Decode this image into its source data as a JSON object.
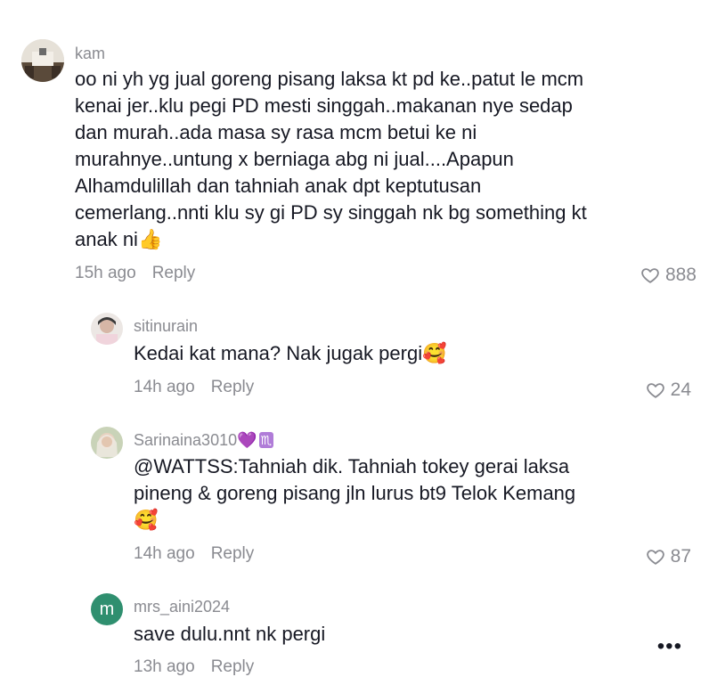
{
  "comments": [
    {
      "username": "kam",
      "text": "oo ni yh yg jual goreng pisang laksa kt pd ke..patut le mcm\nkenai jer..klu pegi PD mesti singgah..makanan nye sedap\ndan murah..ada masa sy rasa mcm betui ke ni\nmurahnye..untung x berniaga abg ni jual....Apapun\nAlhamdulillah dan tahniah anak dpt keptutusan\ncemerlang..nnti klu sy gi PD sy singgah nk bg something kt\nanak ni👍",
      "time": "15h ago",
      "reply_label": "Reply",
      "likes": "888"
    },
    {
      "username": "sitinurain",
      "text": "Kedai kat mana? Nak jugak pergi🥰",
      "time": "14h ago",
      "reply_label": "Reply",
      "likes": "24"
    },
    {
      "username": "Sarinaina3010",
      "username_suffix_heart": "💜",
      "username_suffix_sign": "♏",
      "text": "@WATTSS:Tahniah dik. Tahniah tokey gerai laksa\npineng & goreng pisang jln lurus bt9 Telok Kemang\n🥰",
      "time": "14h ago",
      "reply_label": "Reply",
      "likes": "87"
    },
    {
      "username": "mrs_aini2024",
      "avatar_letter": "m",
      "text": "save dulu.nnt nk pergi",
      "time": "13h ago",
      "reply_label": "Reply"
    }
  ],
  "more_label": "•••",
  "colors": {
    "text": "#161823",
    "muted": "#8a8b91",
    "avatar_m": "#2f8f6f"
  }
}
